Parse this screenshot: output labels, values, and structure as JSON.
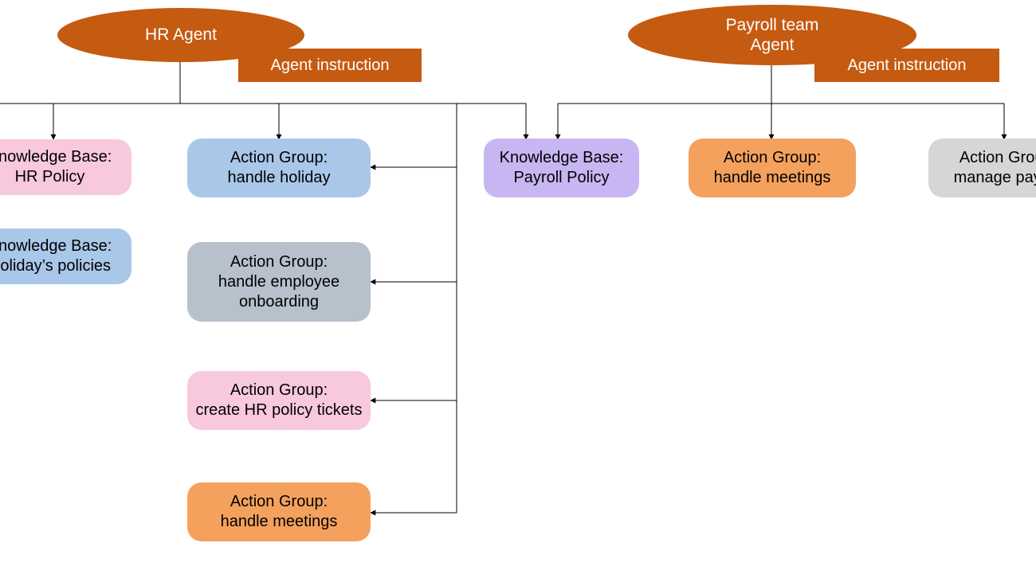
{
  "colors": {
    "brand_orange": "#c55a11",
    "pink": "#f8c8dc",
    "lightblue": "#a9c7e8",
    "greyblue": "#b7c1cc",
    "orange_soft": "#f4a15d",
    "lavender": "#c7b6f2",
    "grey": "#d6d6d6"
  },
  "hr_agent": {
    "label": "HR Agent",
    "instruction_label": "Agent instruction",
    "knowledge_bases": [
      {
        "id": "kb-hr-policy",
        "label": "Knowledge Base: HR Policy"
      },
      {
        "id": "kb-holiday-policies",
        "label": "Knowledge Base: Holiday’s policies"
      }
    ],
    "action_groups": [
      {
        "id": "ag-handle-holiday",
        "label": "Action Group:\nhandle holiday"
      },
      {
        "id": "ag-handle-onboarding",
        "label": "Action Group:\nhandle employee onboarding"
      },
      {
        "id": "ag-hr-policy-tickets",
        "label": "Action Group:\ncreate HR policy tickets"
      },
      {
        "id": "ag-handle-meetings-hr",
        "label": "Action Group:\nhandle meetings"
      }
    ]
  },
  "payroll_agent": {
    "label": "Payroll team\nAgent",
    "instruction_label": "Agent instruction",
    "knowledge_bases": [
      {
        "id": "kb-payroll-policy",
        "label": "Knowledge Base: Payroll Policy"
      }
    ],
    "action_groups": [
      {
        "id": "ag-handle-meetings-payroll",
        "label": "Action Group:\nhandle meetings"
      },
      {
        "id": "ag-manage-payroll",
        "label": "Action Group:\nmanage payroll"
      }
    ]
  }
}
